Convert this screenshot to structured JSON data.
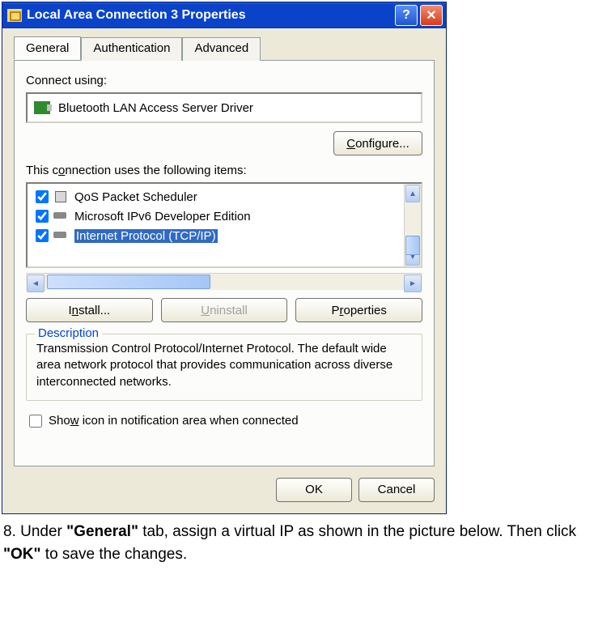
{
  "window": {
    "title": "Local Area Connection 3 Properties"
  },
  "tabs": {
    "general": "General",
    "authentication": "Authentication",
    "advanced": "Advanced"
  },
  "general": {
    "connect_using_label": "Connect using:",
    "adapter_name": "Bluetooth LAN Access Server Driver",
    "configure_btn": "Configure...",
    "items_label": "This connection uses the following items:",
    "items": [
      {
        "label": "QoS Packet Scheduler",
        "checked": true,
        "icon": "qos"
      },
      {
        "label": "Microsoft IPv6 Developer Edition",
        "checked": true,
        "icon": "ipv6"
      },
      {
        "label": "Internet Protocol (TCP/IP)",
        "checked": true,
        "icon": "tcpip",
        "selected": true
      }
    ],
    "install_btn": "Install...",
    "uninstall_btn": "Uninstall",
    "properties_btn": "Properties",
    "description_legend": "Description",
    "description_text": "Transmission Control Protocol/Internet Protocol. The default wide area network protocol that provides communication across diverse interconnected networks.",
    "show_icon_label": "Show icon in notification area when connected",
    "show_icon_checked": false
  },
  "footer": {
    "ok": "OK",
    "cancel": "Cancel"
  },
  "instruction": {
    "number": "8.",
    "pre": " Under ",
    "general_quoted": "\"General\"",
    "mid": " tab, assign a virtual IP as shown in the picture below. Then click ",
    "ok_quoted": "\"OK\"",
    "post": " to save the changes."
  }
}
